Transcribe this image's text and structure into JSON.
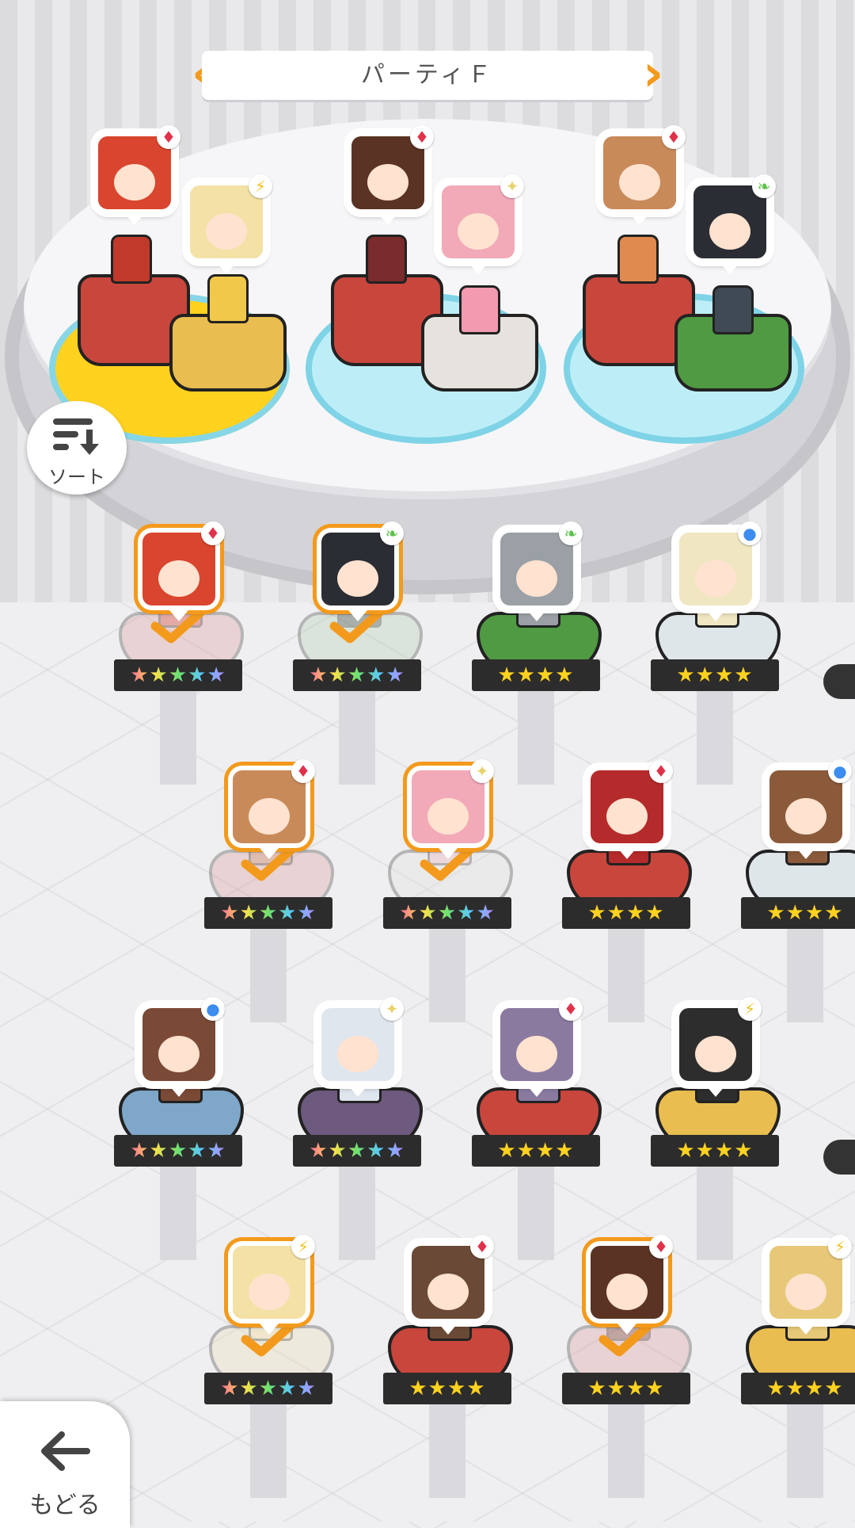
{
  "header": {
    "party_title": "パーティＦ"
  },
  "buttons": {
    "sort_label": "ソート",
    "back_label": "もどる"
  },
  "party": [
    {
      "element": "♦",
      "selected": false
    },
    {
      "element": "⚡",
      "selected": false
    },
    {
      "element": "♦",
      "selected": false
    },
    {
      "element": "✦",
      "selected": false
    },
    {
      "element": "♦",
      "selected": false
    },
    {
      "element": "❧",
      "selected": false
    }
  ],
  "roster": [
    {
      "element": "♦",
      "stars": "★★★★★",
      "in_party": true
    },
    {
      "element": "❧",
      "stars": "★★★★★",
      "in_party": true
    },
    {
      "element": "❧",
      "stars": "★★★★",
      "in_party": false
    },
    {
      "element": "●",
      "stars": "★★★★",
      "in_party": false
    },
    {
      "element": "♦",
      "stars": "★★★★★",
      "in_party": true
    },
    {
      "element": "✦",
      "stars": "★★★★★",
      "in_party": true
    },
    {
      "element": "♦",
      "stars": "★★★★",
      "in_party": false
    },
    {
      "element": "●",
      "stars": "★★★★",
      "in_party": false
    },
    {
      "element": "●",
      "stars": "★★★★★",
      "in_party": false
    },
    {
      "element": "✦",
      "stars": "★★★★★",
      "in_party": false
    },
    {
      "element": "♦",
      "stars": "★★★★",
      "in_party": false
    },
    {
      "element": "⚡",
      "stars": "★★★★",
      "in_party": false
    },
    {
      "element": "⚡",
      "stars": "★★★★★",
      "in_party": true
    },
    {
      "element": "♦",
      "stars": "★★★★",
      "in_party": false
    },
    {
      "element": "♦",
      "stars": "★★★★",
      "in_party": true
    },
    {
      "element": "⚡",
      "stars": "★★★★",
      "in_party": false
    }
  ],
  "colors": {
    "accent": "#f39a1c",
    "fire": "#e0324a",
    "thunder": "#f2c21c",
    "light": "#e8d26a",
    "water": "#3d8cf0",
    "wind": "#5cc24a",
    "dark": "#6a4a9a"
  }
}
